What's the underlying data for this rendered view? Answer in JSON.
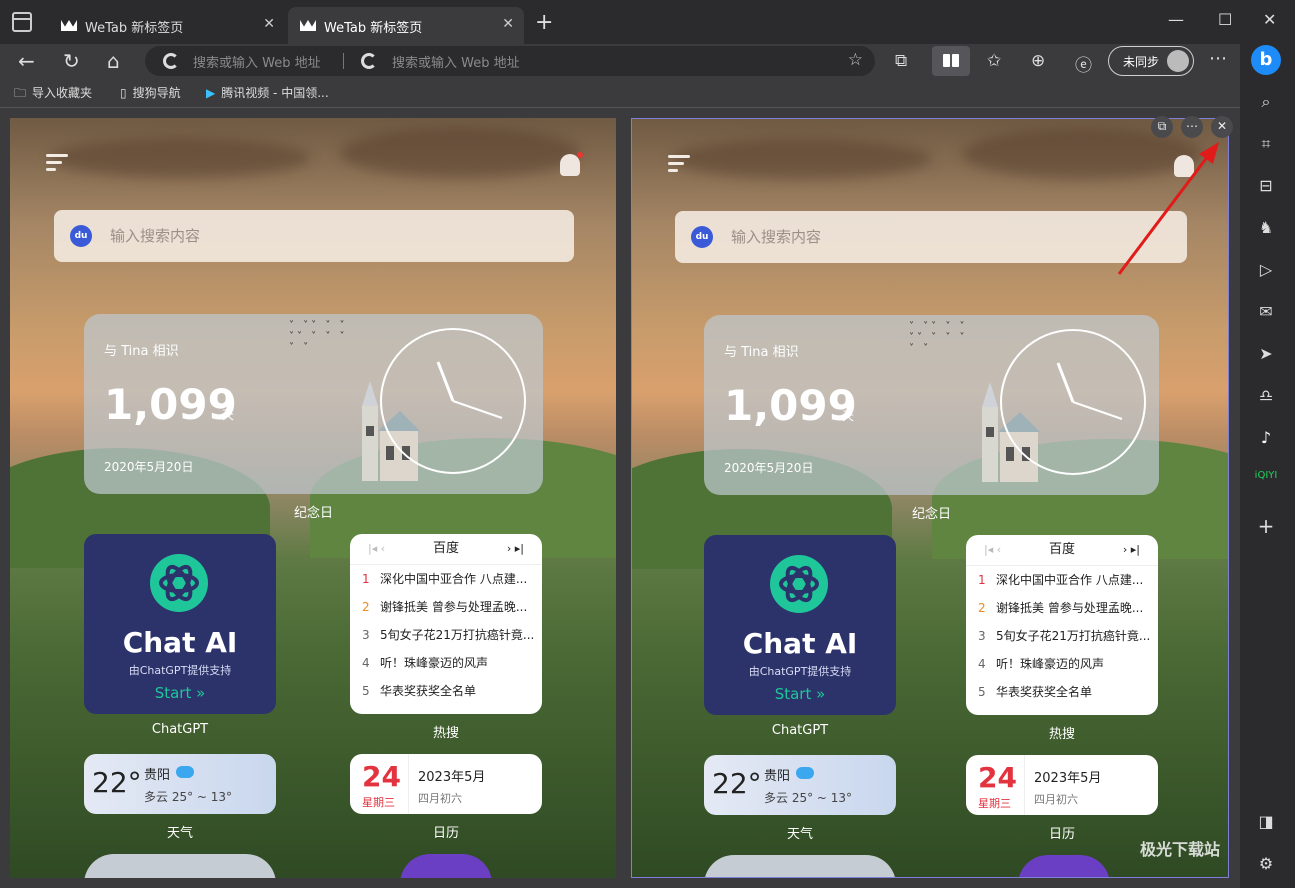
{
  "tabs": [
    {
      "title": "WeTab 新标签页",
      "active": false
    },
    {
      "title": "WeTab 新标签页",
      "active": true
    }
  ],
  "address": {
    "left_placeholder": "搜索或输入 Web 地址",
    "right_placeholder": "搜索或输入 Web 地址"
  },
  "profile": {
    "label": "未同步"
  },
  "bookmarks": [
    {
      "label": "导入收藏夹",
      "icon": "folder-icon"
    },
    {
      "label": "搜狗导航",
      "icon": "page-icon"
    },
    {
      "label": "腾讯视频 - 中国领...",
      "icon": "play-icon"
    }
  ],
  "newtab": {
    "search_placeholder": "输入搜索内容",
    "anniversary": {
      "who": "与 Tina 相识",
      "days": "1,099",
      "unit": "天",
      "date": "2020年5月20日",
      "label": "纪念日"
    },
    "chat": {
      "title": "Chat AI",
      "subtitle": "由ChatGPT提供支持",
      "start": "Start »",
      "label": "ChatGPT"
    },
    "hot": {
      "source": "百度",
      "label": "热搜",
      "items": [
        {
          "rank": "1",
          "text": "深化中国中亚合作 八点建..."
        },
        {
          "rank": "2",
          "text": "谢锋抵美 曾参与处理孟晚..."
        },
        {
          "rank": "3",
          "text": "5旬女子花21万打抗癌针竟..."
        },
        {
          "rank": "4",
          "text": "听！珠峰豪迈的风声"
        },
        {
          "rank": "5",
          "text": "华表奖获奖全名单"
        }
      ]
    },
    "weather": {
      "temp": "22°",
      "city": "贵阳",
      "desc": "多云 25° ~ 13°",
      "label": "天气"
    },
    "calendar": {
      "day": "24",
      "weekday": "星期三",
      "year_month": "2023年5月",
      "lunar": "四月初六",
      "label": "日历"
    }
  },
  "watermark": "极光下载站",
  "colors": {
    "accent_blue": "#1d8bf8",
    "pane_border": "#7d7fd8",
    "hot_rank_1": "#e2333e",
    "hot_rank_2": "#f08a24",
    "chat_green": "#1fc69a",
    "arrow_red": "#e11a1a"
  }
}
